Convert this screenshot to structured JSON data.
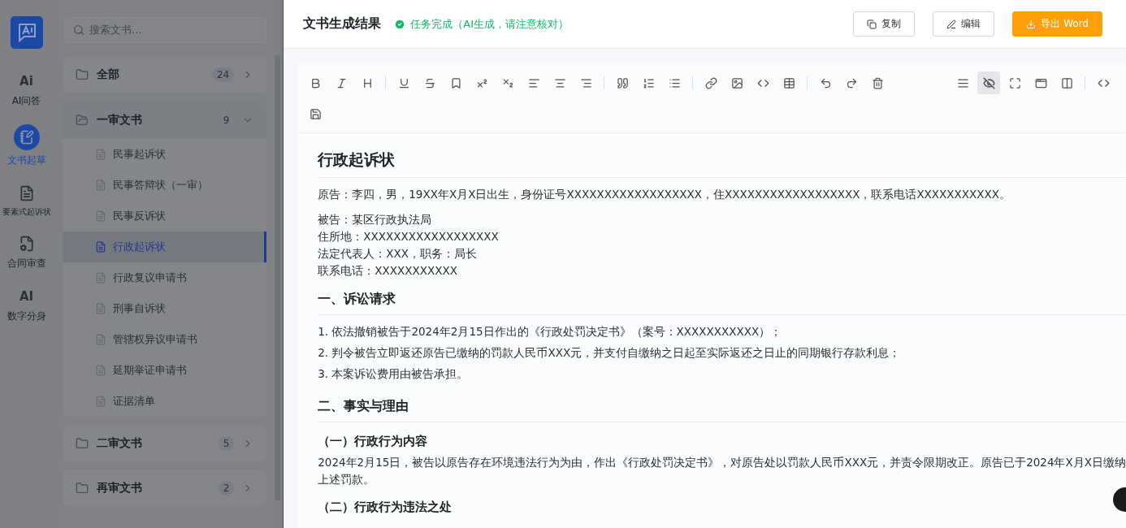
{
  "rail": {
    "items": [
      {
        "label": "AI问答",
        "icon_text": "Ai",
        "selected": false
      },
      {
        "label": "文书起草",
        "selected": true
      },
      {
        "label": "要素式起诉状",
        "selected": false
      },
      {
        "label": "合同审查",
        "selected": false
      },
      {
        "label": "数字分身",
        "icon_text": "AI",
        "selected": false
      }
    ]
  },
  "doc_list": {
    "search": {
      "placeholder": "搜索文书..."
    },
    "folders": [
      {
        "name": "全部",
        "count": "24",
        "expanded": false
      },
      {
        "name": "一审文书",
        "count": "9",
        "expanded": true,
        "children": [
          {
            "name": "民事起诉状",
            "selected": false
          },
          {
            "name": "民事答辩状（一审）",
            "selected": false
          },
          {
            "name": "民事反诉状",
            "selected": false
          },
          {
            "name": "行政起诉状",
            "selected": true
          },
          {
            "name": "行政复议申请书",
            "selected": false
          },
          {
            "name": "刑事自诉状",
            "selected": false
          },
          {
            "name": "管辖权异议申请书",
            "selected": false
          },
          {
            "name": "延期举证申请书",
            "selected": false
          },
          {
            "name": "证据清单",
            "selected": false
          }
        ]
      },
      {
        "name": "二审文书",
        "count": "5",
        "expanded": false
      },
      {
        "name": "再审文书",
        "count": "2",
        "expanded": false
      }
    ]
  },
  "result": {
    "title": "文书生成结果",
    "status": "任务完成（AI生成，请注意核对）",
    "buttons": [
      {
        "label": "复制",
        "kind": "copy"
      },
      {
        "label": "编辑",
        "kind": "edit"
      },
      {
        "label": "导出 Word",
        "kind": "export"
      }
    ],
    "toolbar": {
      "buttons": [
        {
          "selected": false
        },
        {
          "selected": false
        },
        {
          "selected": false
        },
        {
          "selected": false
        },
        {
          "selected": false
        },
        {
          "selected": false
        },
        {
          "selected": false
        },
        {
          "selected": false
        },
        {
          "selected": false
        },
        {
          "selected": false
        },
        {
          "selected": false
        },
        {
          "selected": false
        },
        {
          "selected": false
        },
        {
          "selected": false
        },
        {
          "selected": false
        },
        {
          "selected": false
        },
        {
          "selected": false
        },
        {
          "selected": false
        },
        {
          "selected": false
        },
        {
          "selected": false
        },
        {
          "selected": false
        },
        {
          "selected": false
        },
        {
          "selected": true
        },
        {
          "selected": false
        },
        {
          "selected": false
        },
        {
          "selected": false
        },
        {
          "selected": false
        },
        {
          "selected": false
        }
      ]
    },
    "document": [
      {
        "kind": "title",
        "text": "行政起诉状"
      },
      {
        "kind": "para",
        "lines": [
          "原告：李四，男，19XX年X月X日出生，身份证号XXXXXXXXXXXXXXXXXX，住XXXXXXXXXXXXXXXXXX，联系电话XXXXXXXXXXX。"
        ]
      },
      {
        "kind": "para",
        "lines": [
          "被告：某区行政执法局",
          "住所地：XXXXXXXXXXXXXXXXXX",
          "法定代表人：XXX，职务：局长",
          "联系电话：XXXXXXXXXXX"
        ]
      },
      {
        "kind": "heading",
        "text": "一、诉讼请求"
      },
      {
        "kind": "list",
        "items": [
          "1. 依法撤销被告于2024年2月15日作出的《行政处罚决定书》（案号：XXXXXXXXXXX）；",
          "2. 判令被告立即返还原告已缴纳的罚款人民币XXX元，并支付自缴纳之日起至实际返还之日止的同期银行存款利息；",
          "3. 本案诉讼费用由被告承担。"
        ]
      },
      {
        "kind": "heading",
        "text": "二、事实与理由"
      },
      {
        "kind": "subheading",
        "text": "（一）行政行为内容"
      },
      {
        "kind": "para",
        "lines": [
          "2024年2月15日，被告以原告存在环境违法行为为由，作出《行政处罚决定书》，对原告处以罚款人民币XXX元，并责令限期改正。原告已于2024年X月X日缴纳",
          "上述罚款。"
        ]
      },
      {
        "kind": "subheading",
        "text": "（二）行政行为违法之处"
      }
    ]
  }
}
